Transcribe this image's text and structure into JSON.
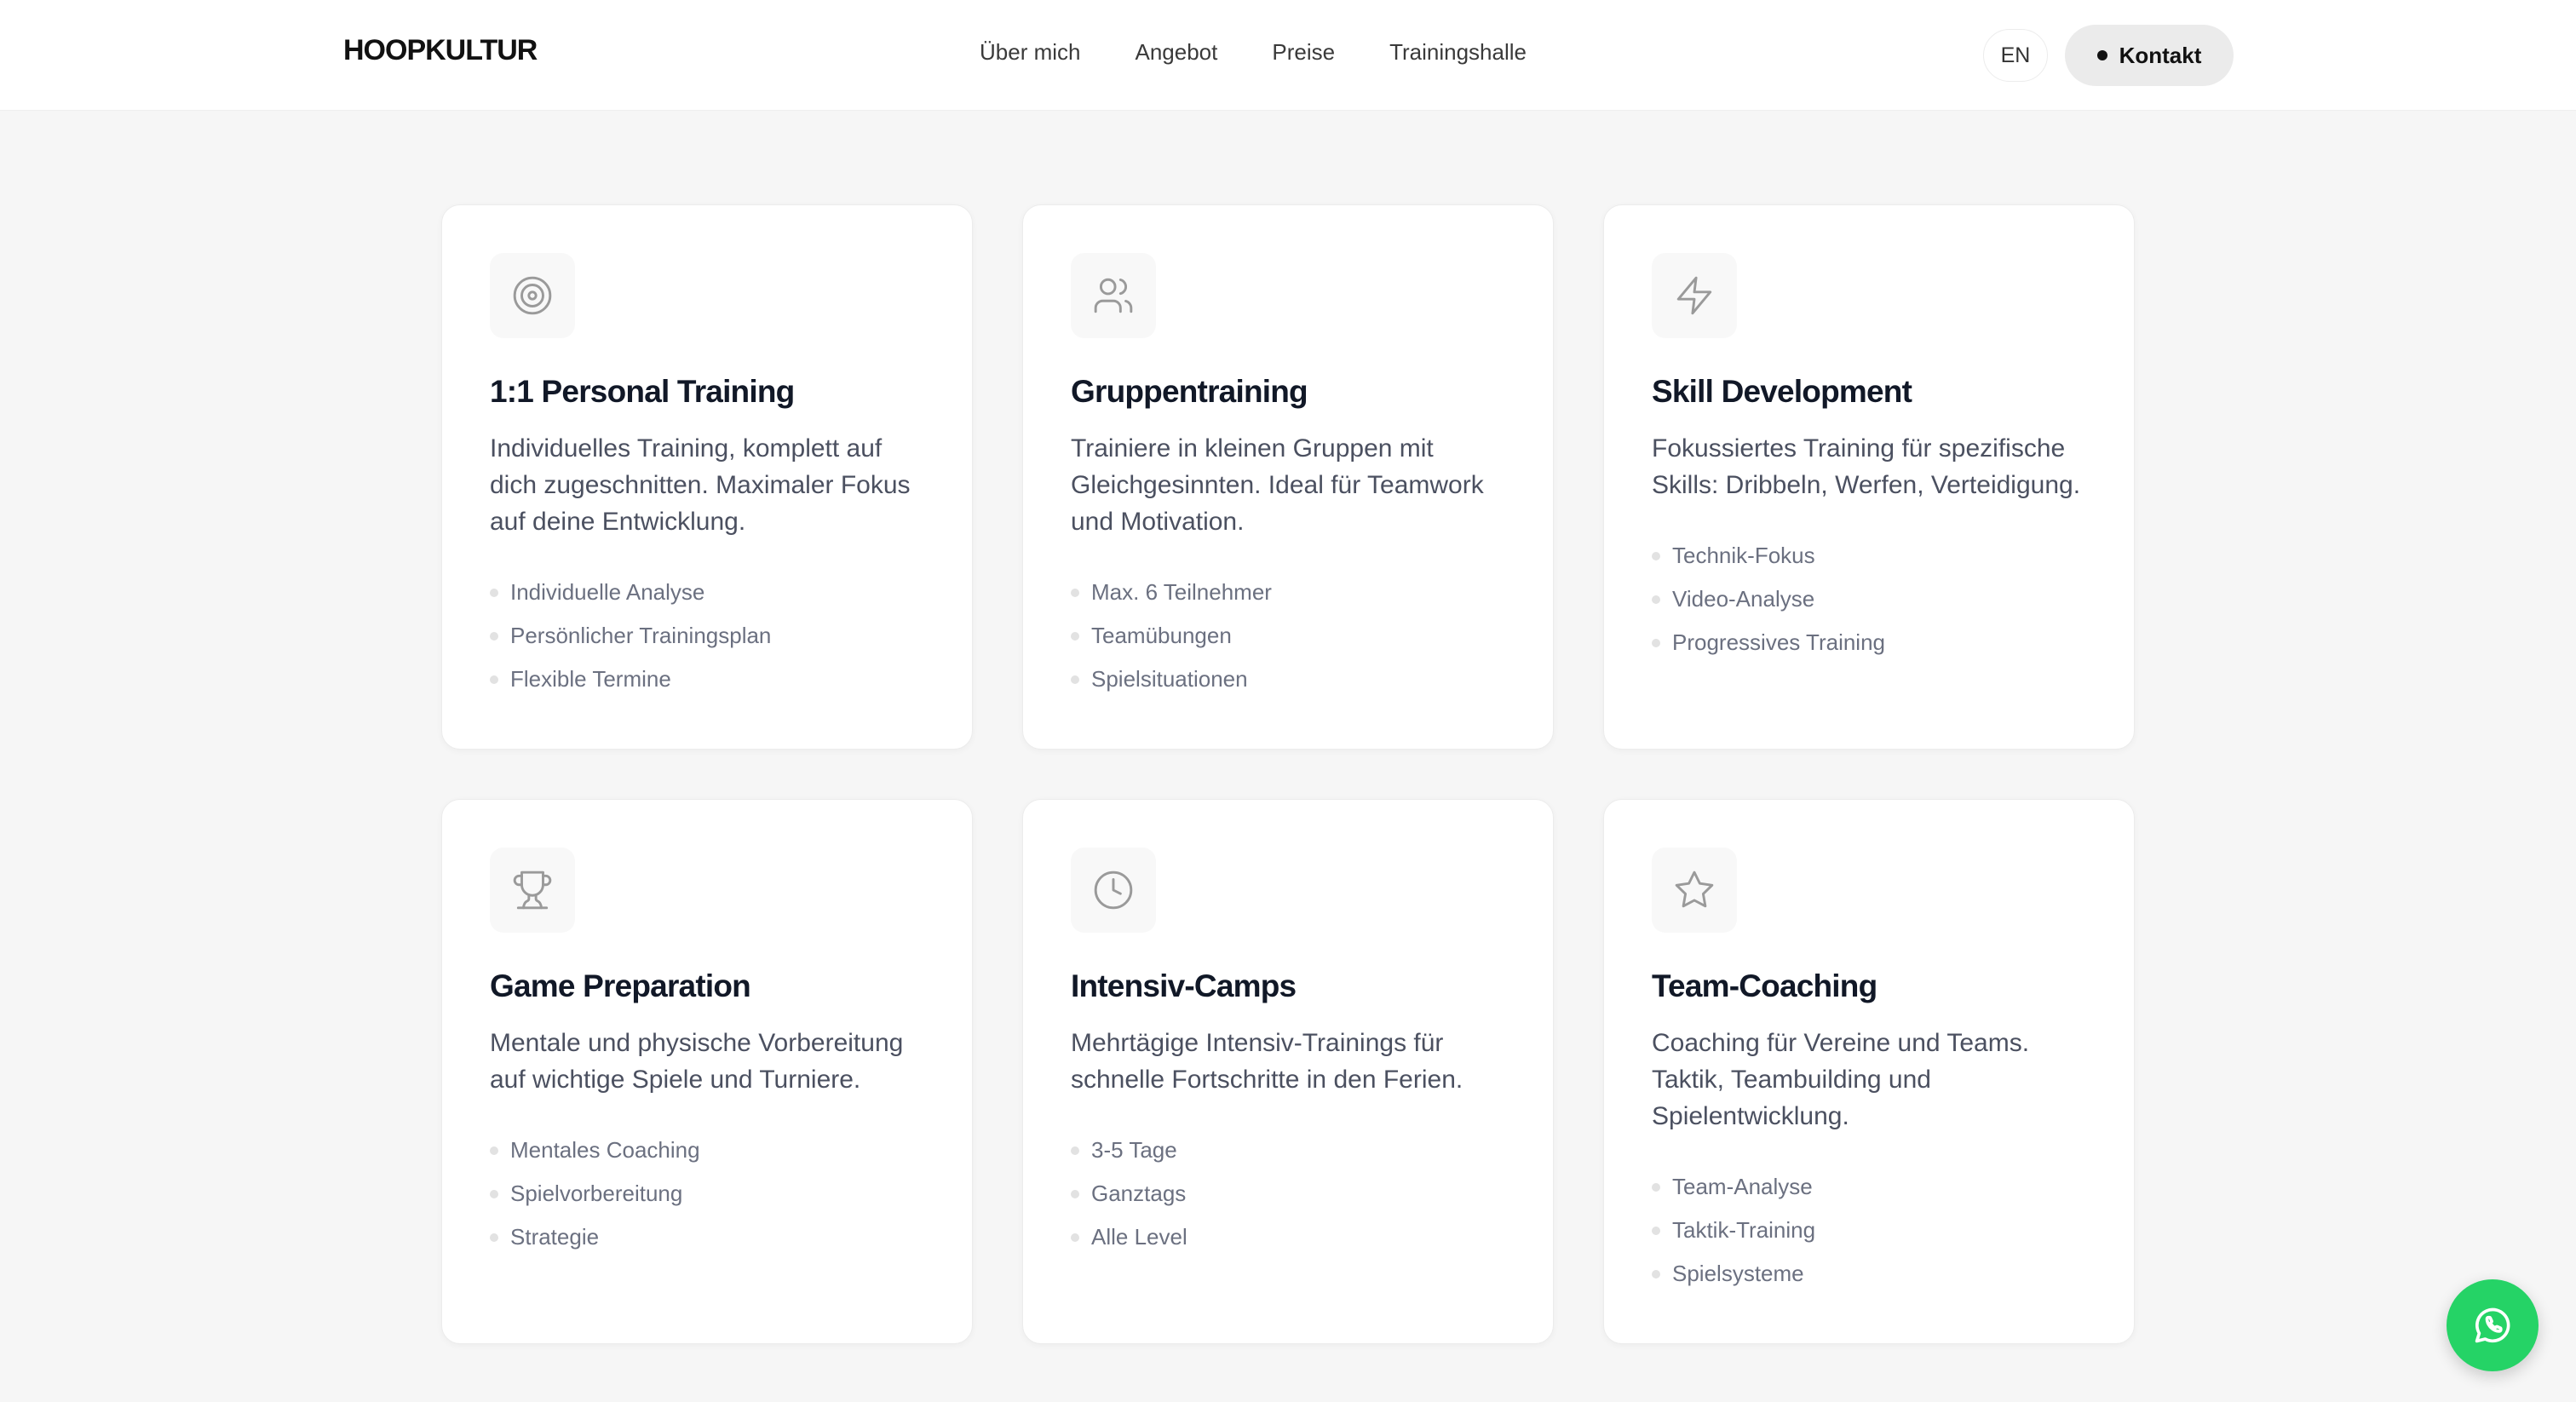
{
  "header": {
    "logo": "HOOPKULTUR",
    "nav": [
      "Über mich",
      "Angebot",
      "Preise",
      "Trainingshalle"
    ],
    "lang": "EN",
    "contact": "Kontakt"
  },
  "cards": [
    {
      "icon": "target-icon",
      "title": "1:1 Personal Training",
      "desc": "Individuelles Training, komplett auf dich zugeschnitten. Maximaler Fokus auf deine Entwicklung.",
      "features": [
        "Individuelle Analyse",
        "Persönlicher Trainingsplan",
        "Flexible Termine"
      ]
    },
    {
      "icon": "users-icon",
      "title": "Gruppentraining",
      "desc": "Trainiere in kleinen Gruppen mit Gleichgesinnten. Ideal für Teamwork und Motivation.",
      "features": [
        "Max. 6 Teilnehmer",
        "Teamübungen",
        "Spielsituationen"
      ]
    },
    {
      "icon": "zap-icon",
      "title": "Skill Development",
      "desc": "Fokussiertes Training für spezifische Skills: Dribbeln, Werfen, Verteidigung.",
      "features": [
        "Technik-Fokus",
        "Video-Analyse",
        "Progressives Training"
      ]
    },
    {
      "icon": "trophy-icon",
      "title": "Game Preparation",
      "desc": "Mentale und physische Vorbereitung auf wichtige Spiele und Turniere.",
      "features": [
        "Mentales Coaching",
        "Spielvorbereitung",
        "Strategie"
      ]
    },
    {
      "icon": "clock-icon",
      "title": "Intensiv-Camps",
      "desc": "Mehrtägige Intensiv-Trainings für schnelle Fortschritte in den Ferien.",
      "features": [
        "3-5 Tage",
        "Ganztags",
        "Alle Level"
      ]
    },
    {
      "icon": "star-icon",
      "title": "Team-Coaching",
      "desc": "Coaching für Vereine und Teams. Taktik, Teambuilding und Spielentwicklung.",
      "features": [
        "Team-Analyse",
        "Taktik-Training",
        "Spielsysteme"
      ]
    }
  ],
  "colors": {
    "background": "#f6f6f6",
    "card": "#ffffff",
    "title": "#111827",
    "text": "#4b5060",
    "feature": "#6b7080",
    "whatsapp": "#25d366"
  },
  "whatsapp": {
    "icon": "whatsapp-icon"
  }
}
